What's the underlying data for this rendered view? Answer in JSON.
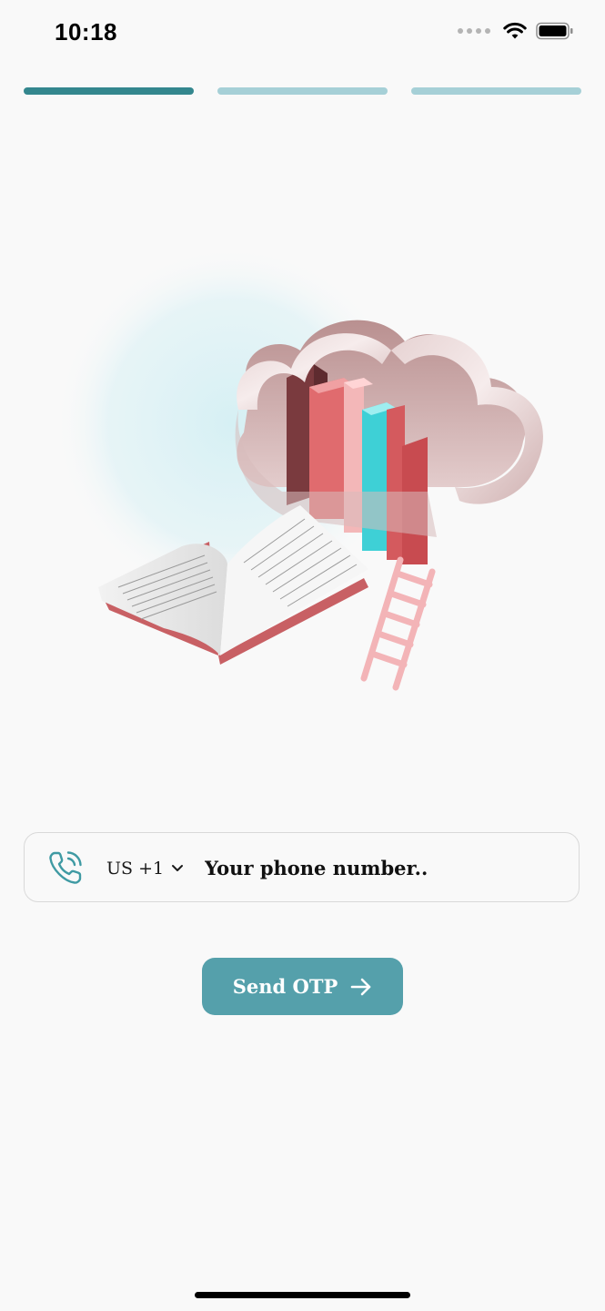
{
  "status_bar": {
    "time": "10:18",
    "icons": [
      "cellular-signal-icon",
      "wifi-icon",
      "battery-icon"
    ]
  },
  "progress": {
    "total_steps": 3,
    "current_step": 1,
    "active_color": "#34878e",
    "inactive_color": "#a6d0d7"
  },
  "hero": {
    "illustration": "cloud-library-books-ladder-illustration"
  },
  "phone_form": {
    "icon": "phone-icon",
    "country_code": "US +1",
    "country_chevron": "chevron-down-icon",
    "phone_placeholder": "Your phone number..",
    "phone_value": ""
  },
  "otp_button": {
    "label": "Send OTP",
    "icon": "arrow-right-icon",
    "color": "#55a0ab"
  },
  "colors": {
    "background": "#f9f9f9",
    "accent": "#55a0ab",
    "text": "#1a1a1a"
  }
}
